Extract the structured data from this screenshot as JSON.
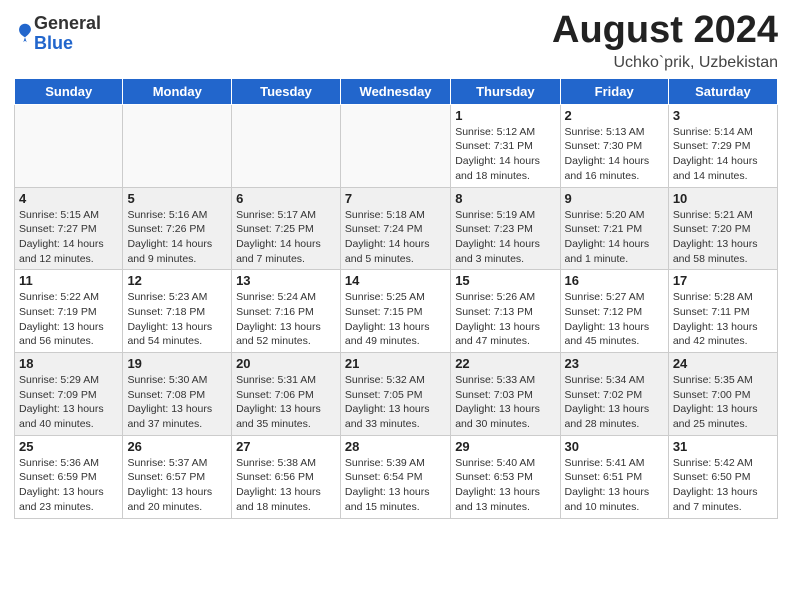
{
  "header": {
    "logo_general": "General",
    "logo_blue": "Blue",
    "month_year": "August 2024",
    "location": "Uchko`prik, Uzbekistan"
  },
  "days_of_week": [
    "Sunday",
    "Monday",
    "Tuesday",
    "Wednesday",
    "Thursday",
    "Friday",
    "Saturday"
  ],
  "weeks": [
    [
      {
        "day": "",
        "info": ""
      },
      {
        "day": "",
        "info": ""
      },
      {
        "day": "",
        "info": ""
      },
      {
        "day": "",
        "info": ""
      },
      {
        "day": "1",
        "info": "Sunrise: 5:12 AM\nSunset: 7:31 PM\nDaylight: 14 hours\nand 18 minutes."
      },
      {
        "day": "2",
        "info": "Sunrise: 5:13 AM\nSunset: 7:30 PM\nDaylight: 14 hours\nand 16 minutes."
      },
      {
        "day": "3",
        "info": "Sunrise: 5:14 AM\nSunset: 7:29 PM\nDaylight: 14 hours\nand 14 minutes."
      }
    ],
    [
      {
        "day": "4",
        "info": "Sunrise: 5:15 AM\nSunset: 7:27 PM\nDaylight: 14 hours\nand 12 minutes."
      },
      {
        "day": "5",
        "info": "Sunrise: 5:16 AM\nSunset: 7:26 PM\nDaylight: 14 hours\nand 9 minutes."
      },
      {
        "day": "6",
        "info": "Sunrise: 5:17 AM\nSunset: 7:25 PM\nDaylight: 14 hours\nand 7 minutes."
      },
      {
        "day": "7",
        "info": "Sunrise: 5:18 AM\nSunset: 7:24 PM\nDaylight: 14 hours\nand 5 minutes."
      },
      {
        "day": "8",
        "info": "Sunrise: 5:19 AM\nSunset: 7:23 PM\nDaylight: 14 hours\nand 3 minutes."
      },
      {
        "day": "9",
        "info": "Sunrise: 5:20 AM\nSunset: 7:21 PM\nDaylight: 14 hours\nand 1 minute."
      },
      {
        "day": "10",
        "info": "Sunrise: 5:21 AM\nSunset: 7:20 PM\nDaylight: 13 hours\nand 58 minutes."
      }
    ],
    [
      {
        "day": "11",
        "info": "Sunrise: 5:22 AM\nSunset: 7:19 PM\nDaylight: 13 hours\nand 56 minutes."
      },
      {
        "day": "12",
        "info": "Sunrise: 5:23 AM\nSunset: 7:18 PM\nDaylight: 13 hours\nand 54 minutes."
      },
      {
        "day": "13",
        "info": "Sunrise: 5:24 AM\nSunset: 7:16 PM\nDaylight: 13 hours\nand 52 minutes."
      },
      {
        "day": "14",
        "info": "Sunrise: 5:25 AM\nSunset: 7:15 PM\nDaylight: 13 hours\nand 49 minutes."
      },
      {
        "day": "15",
        "info": "Sunrise: 5:26 AM\nSunset: 7:13 PM\nDaylight: 13 hours\nand 47 minutes."
      },
      {
        "day": "16",
        "info": "Sunrise: 5:27 AM\nSunset: 7:12 PM\nDaylight: 13 hours\nand 45 minutes."
      },
      {
        "day": "17",
        "info": "Sunrise: 5:28 AM\nSunset: 7:11 PM\nDaylight: 13 hours\nand 42 minutes."
      }
    ],
    [
      {
        "day": "18",
        "info": "Sunrise: 5:29 AM\nSunset: 7:09 PM\nDaylight: 13 hours\nand 40 minutes."
      },
      {
        "day": "19",
        "info": "Sunrise: 5:30 AM\nSunset: 7:08 PM\nDaylight: 13 hours\nand 37 minutes."
      },
      {
        "day": "20",
        "info": "Sunrise: 5:31 AM\nSunset: 7:06 PM\nDaylight: 13 hours\nand 35 minutes."
      },
      {
        "day": "21",
        "info": "Sunrise: 5:32 AM\nSunset: 7:05 PM\nDaylight: 13 hours\nand 33 minutes."
      },
      {
        "day": "22",
        "info": "Sunrise: 5:33 AM\nSunset: 7:03 PM\nDaylight: 13 hours\nand 30 minutes."
      },
      {
        "day": "23",
        "info": "Sunrise: 5:34 AM\nSunset: 7:02 PM\nDaylight: 13 hours\nand 28 minutes."
      },
      {
        "day": "24",
        "info": "Sunrise: 5:35 AM\nSunset: 7:00 PM\nDaylight: 13 hours\nand 25 minutes."
      }
    ],
    [
      {
        "day": "25",
        "info": "Sunrise: 5:36 AM\nSunset: 6:59 PM\nDaylight: 13 hours\nand 23 minutes."
      },
      {
        "day": "26",
        "info": "Sunrise: 5:37 AM\nSunset: 6:57 PM\nDaylight: 13 hours\nand 20 minutes."
      },
      {
        "day": "27",
        "info": "Sunrise: 5:38 AM\nSunset: 6:56 PM\nDaylight: 13 hours\nand 18 minutes."
      },
      {
        "day": "28",
        "info": "Sunrise: 5:39 AM\nSunset: 6:54 PM\nDaylight: 13 hours\nand 15 minutes."
      },
      {
        "day": "29",
        "info": "Sunrise: 5:40 AM\nSunset: 6:53 PM\nDaylight: 13 hours\nand 13 minutes."
      },
      {
        "day": "30",
        "info": "Sunrise: 5:41 AM\nSunset: 6:51 PM\nDaylight: 13 hours\nand 10 minutes."
      },
      {
        "day": "31",
        "info": "Sunrise: 5:42 AM\nSunset: 6:50 PM\nDaylight: 13 hours\nand 7 minutes."
      }
    ]
  ]
}
